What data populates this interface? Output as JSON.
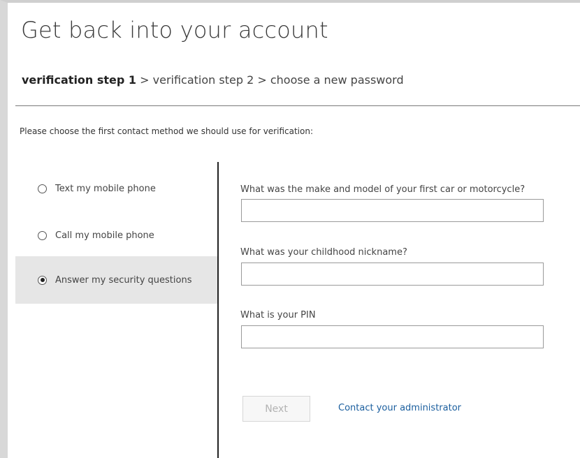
{
  "page": {
    "title": "Get back into your account"
  },
  "breadcrumb": {
    "step1": "verification step 1",
    "sep1": " > ",
    "step2": "verification step 2",
    "sep2": " > ",
    "step3": "choose a new password"
  },
  "instruction": "Please choose the first contact method we should use for verification:",
  "methods": [
    {
      "label": "Text my mobile phone",
      "selected": false
    },
    {
      "label": "Call my mobile phone",
      "selected": false
    },
    {
      "label": "Answer my security questions",
      "selected": true
    }
  ],
  "questions": [
    {
      "label": "What was the make and model of your first car or motorcycle?",
      "value": ""
    },
    {
      "label": "What was your childhood nickname?",
      "value": ""
    },
    {
      "label": "What is your PIN",
      "value": ""
    }
  ],
  "actions": {
    "next_label": "Next",
    "contact_admin": "Contact your administrator"
  },
  "colors": {
    "link": "#1a5e9e",
    "selected_bg": "#e6e6e6",
    "disabled_text": "#b3b3b3"
  }
}
